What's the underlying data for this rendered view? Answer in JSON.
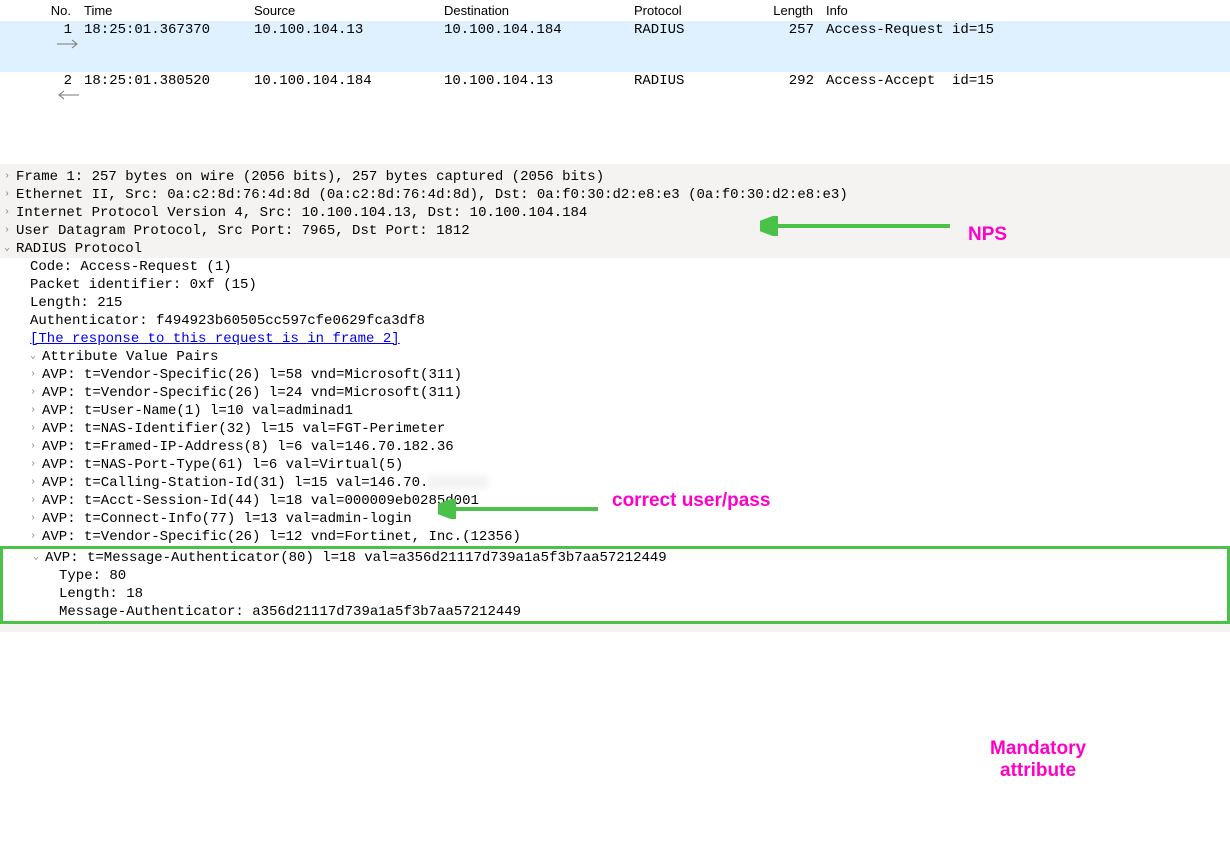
{
  "columns": {
    "no": "No.",
    "time": "Time",
    "source": "Source",
    "destination": "Destination",
    "protocol": "Protocol",
    "length": "Length",
    "info": "Info"
  },
  "packets": [
    {
      "no": "1",
      "time": "18:25:01.367370",
      "source": "10.100.104.13",
      "destination": "10.100.104.184",
      "protocol": "RADIUS",
      "length": "257",
      "info": "Access-Request id=15",
      "selected": true,
      "direction": "right"
    },
    {
      "no": "2",
      "time": "18:25:01.380520",
      "source": "10.100.104.184",
      "destination": "10.100.104.13",
      "protocol": "RADIUS",
      "length": "292",
      "info": "Access-Accept  id=15",
      "selected": false,
      "direction": "left"
    }
  ],
  "details": {
    "frame": "Frame 1: 257 bytes on wire (2056 bits), 257 bytes captured (2056 bits)",
    "ethernet": "Ethernet II, Src: 0a:c2:8d:76:4d:8d (0a:c2:8d:76:4d:8d), Dst: 0a:f0:30:d2:e8:e3 (0a:f0:30:d2:e8:e3)",
    "ip": "Internet Protocol Version 4, Src: 10.100.104.13, Dst: 10.100.104.184",
    "udp": "User Datagram Protocol, Src Port: 7965, Dst Port: 1812",
    "radius_header": "RADIUS Protocol",
    "radius": {
      "code": "Code: Access-Request (1)",
      "pkt_id": "Packet identifier: 0xf (15)",
      "length": "Length: 215",
      "authenticator": "Authenticator: f494923b60505cc597cfe0629fca3df8",
      "response_link": "[The response to this request is in frame 2]",
      "avp_header": "Attribute Value Pairs",
      "avps": [
        "AVP: t=Vendor-Specific(26) l=58 vnd=Microsoft(311)",
        "AVP: t=Vendor-Specific(26) l=24 vnd=Microsoft(311)",
        "AVP: t=User-Name(1) l=10 val=adminad1",
        "AVP: t=NAS-Identifier(32) l=15 val=FGT-Perimeter",
        "AVP: t=Framed-IP-Address(8) l=6 val=146.70.182.36",
        "AVP: t=NAS-Port-Type(61) l=6 val=Virtual(5)",
        "AVP: t=Calling-Station-Id(31) l=15 val=146.70.",
        "AVP: t=Acct-Session-Id(44) l=18 val=000009eb0285d001",
        "AVP: t=Connect-Info(77) l=13 val=admin-login",
        "AVP: t=Vendor-Specific(26) l=12 vnd=Fortinet, Inc.(12356)"
      ],
      "msg_auth": {
        "line": "AVP: t=Message-Authenticator(80) l=18 val=a356d21117d739a1a5f3b7aa57212449",
        "type": "Type: 80",
        "length": "Length: 18",
        "value": "Message-Authenticator: a356d21117d739a1a5f3b7aa57212449"
      }
    }
  },
  "annotations": {
    "nps": "NPS",
    "userpass": "correct user/pass",
    "mandatory1": "Mandatory",
    "mandatory2": "attribute"
  }
}
